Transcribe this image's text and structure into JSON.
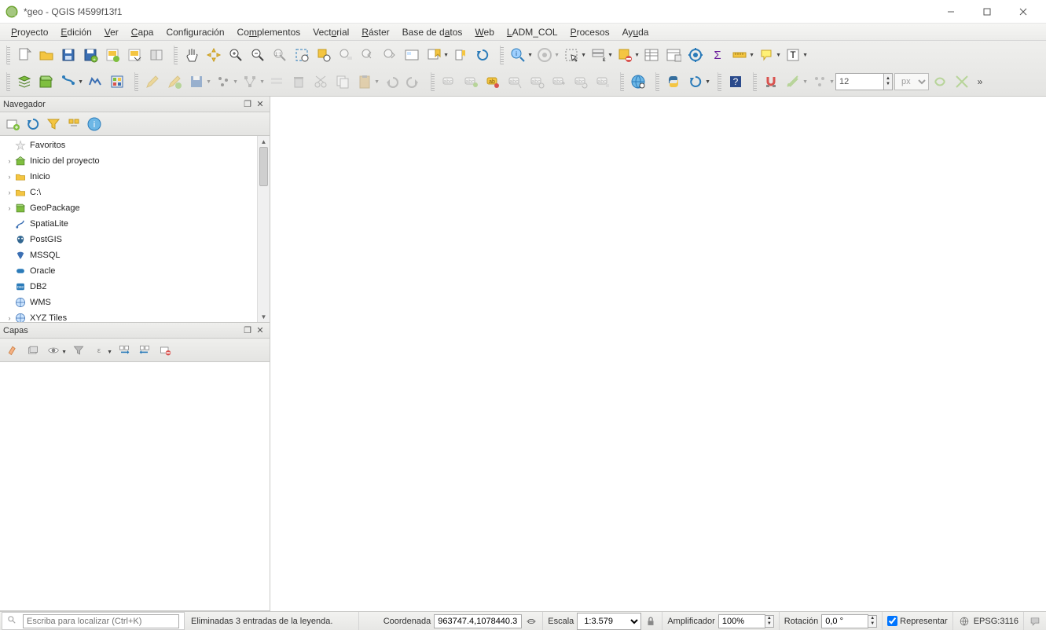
{
  "window": {
    "title": "*geo - QGIS f4599f13f1"
  },
  "menu": {
    "items": [
      {
        "label": "Proyecto",
        "mn": "P"
      },
      {
        "label": "Edición",
        "mn": "E"
      },
      {
        "label": "Ver",
        "mn": "V"
      },
      {
        "label": "Capa",
        "mn": "C"
      },
      {
        "label": "Configuración",
        "mn": "C"
      },
      {
        "label": "Complementos",
        "mn": "C"
      },
      {
        "label": "Vectorial",
        "mn": "V"
      },
      {
        "label": "Ráster",
        "mn": "R"
      },
      {
        "label": "Base de datos",
        "mn": "a"
      },
      {
        "label": "Web",
        "mn": "W"
      },
      {
        "label": "LADM_COL",
        "mn": "L"
      },
      {
        "label": "Procesos",
        "mn": "P"
      },
      {
        "label": "Ayuda",
        "mn": "A"
      }
    ]
  },
  "toolbar": {
    "line_size_value": "12",
    "line_size_unit": "px"
  },
  "panels": {
    "browser": {
      "title": "Navegador",
      "items": [
        {
          "caret": "",
          "icon": "star",
          "label": "Favoritos"
        },
        {
          "caret": "›",
          "icon": "project-home",
          "label": "Inicio del proyecto"
        },
        {
          "caret": "›",
          "icon": "folder",
          "label": "Inicio"
        },
        {
          "caret": "›",
          "icon": "folder",
          "label": "C:\\"
        },
        {
          "caret": "›",
          "icon": "geopackage",
          "label": "GeoPackage"
        },
        {
          "caret": "",
          "icon": "spatialite",
          "label": "SpatiaLite"
        },
        {
          "caret": "",
          "icon": "postgis",
          "label": "PostGIS"
        },
        {
          "caret": "",
          "icon": "mssql",
          "label": "MSSQL"
        },
        {
          "caret": "",
          "icon": "oracle",
          "label": "Oracle"
        },
        {
          "caret": "",
          "icon": "db2",
          "label": "DB2"
        },
        {
          "caret": "",
          "icon": "wms",
          "label": "WMS"
        },
        {
          "caret": "›",
          "icon": "xyz",
          "label": "XYZ Tiles"
        }
      ]
    },
    "layers": {
      "title": "Capas"
    }
  },
  "status": {
    "locator_placeholder": "Escriba para localizar (Ctrl+K)",
    "message": "Eliminadas 3 entradas de la leyenda.",
    "coord_label": "Coordenada",
    "coord_value": "963747.4,1078440.3",
    "scale_label": "Escala",
    "scale_value": "1:3.579",
    "magnifier_label": "Amplificador",
    "magnifier_value": "100%",
    "rotation_label": "Rotación",
    "rotation_value": "0,0 °",
    "render_label": "Representar",
    "crs_label": "EPSG:3116"
  }
}
